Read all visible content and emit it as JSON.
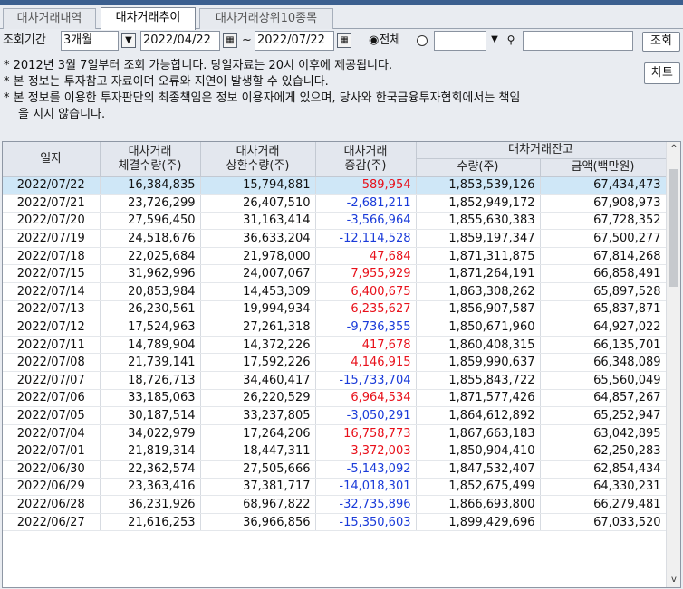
{
  "tabs": [
    {
      "label": "대차거래내역",
      "active": false
    },
    {
      "label": "대차거래추이",
      "active": true
    },
    {
      "label": "대차거래상위10종목",
      "active": false
    }
  ],
  "filter": {
    "period_label": "조회기간",
    "period_value": "3개월",
    "start_date": "2022/04/22",
    "end_date": "2022/07/22",
    "tilde": "~",
    "all_label": "◉전체",
    "stock_code": "",
    "stock_name": "",
    "search_button": "조회",
    "chart_button": "차트"
  },
  "notes": [
    "* 2012년 3월 7일부터 조회 가능합니다. 당일자료는 20시 이후에 제공됩니다.",
    "* 본 정보는 투자참고 자료이며 오류와 지연이 발생할 수 있습니다.",
    "* 본 정보를 이용한 투자판단의 최종책임은 정보 이용자에게 있으며, 당사와 한국금융투자협회에서는 책임",
    "을 지지 않습니다."
  ],
  "table": {
    "headers": {
      "date": "일자",
      "contract_l1": "대차거래",
      "contract_l2": "체결수량(주)",
      "repay_l1": "대차거래",
      "repay_l2": "상환수량(주)",
      "change_l1": "대차거래",
      "change_l2": "증감(주)",
      "balance": "대차거래잔고",
      "bal_qty": "수량(주)",
      "bal_amt": "금액(백만원)"
    },
    "rows": [
      {
        "date": "2022/07/22",
        "contract": "16,384,835",
        "repay": "15,794,881",
        "change": "589,954",
        "qty": "1,853,539,126",
        "amt": "67,434,473"
      },
      {
        "date": "2022/07/21",
        "contract": "23,726,299",
        "repay": "26,407,510",
        "change": "-2,681,211",
        "qty": "1,852,949,172",
        "amt": "67,908,973"
      },
      {
        "date": "2022/07/20",
        "contract": "27,596,450",
        "repay": "31,163,414",
        "change": "-3,566,964",
        "qty": "1,855,630,383",
        "amt": "67,728,352"
      },
      {
        "date": "2022/07/19",
        "contract": "24,518,676",
        "repay": "36,633,204",
        "change": "-12,114,528",
        "qty": "1,859,197,347",
        "amt": "67,500,277"
      },
      {
        "date": "2022/07/18",
        "contract": "22,025,684",
        "repay": "21,978,000",
        "change": "47,684",
        "qty": "1,871,311,875",
        "amt": "67,814,268"
      },
      {
        "date": "2022/07/15",
        "contract": "31,962,996",
        "repay": "24,007,067",
        "change": "7,955,929",
        "qty": "1,871,264,191",
        "amt": "66,858,491"
      },
      {
        "date": "2022/07/14",
        "contract": "20,853,984",
        "repay": "14,453,309",
        "change": "6,400,675",
        "qty": "1,863,308,262",
        "amt": "65,897,528"
      },
      {
        "date": "2022/07/13",
        "contract": "26,230,561",
        "repay": "19,994,934",
        "change": "6,235,627",
        "qty": "1,856,907,587",
        "amt": "65,837,871"
      },
      {
        "date": "2022/07/12",
        "contract": "17,524,963",
        "repay": "27,261,318",
        "change": "-9,736,355",
        "qty": "1,850,671,960",
        "amt": "64,927,022"
      },
      {
        "date": "2022/07/11",
        "contract": "14,789,904",
        "repay": "14,372,226",
        "change": "417,678",
        "qty": "1,860,408,315",
        "amt": "66,135,701"
      },
      {
        "date": "2022/07/08",
        "contract": "21,739,141",
        "repay": "17,592,226",
        "change": "4,146,915",
        "qty": "1,859,990,637",
        "amt": "66,348,089"
      },
      {
        "date": "2022/07/07",
        "contract": "18,726,713",
        "repay": "34,460,417",
        "change": "-15,733,704",
        "qty": "1,855,843,722",
        "amt": "65,560,049"
      },
      {
        "date": "2022/07/06",
        "contract": "33,185,063",
        "repay": "26,220,529",
        "change": "6,964,534",
        "qty": "1,871,577,426",
        "amt": "64,857,267"
      },
      {
        "date": "2022/07/05",
        "contract": "30,187,514",
        "repay": "33,237,805",
        "change": "-3,050,291",
        "qty": "1,864,612,892",
        "amt": "65,252,947"
      },
      {
        "date": "2022/07/04",
        "contract": "34,022,979",
        "repay": "17,264,206",
        "change": "16,758,773",
        "qty": "1,867,663,183",
        "amt": "63,042,895"
      },
      {
        "date": "2022/07/01",
        "contract": "21,819,314",
        "repay": "18,447,311",
        "change": "3,372,003",
        "qty": "1,850,904,410",
        "amt": "62,250,283"
      },
      {
        "date": "2022/06/30",
        "contract": "22,362,574",
        "repay": "27,505,666",
        "change": "-5,143,092",
        "qty": "1,847,532,407",
        "amt": "62,854,434"
      },
      {
        "date": "2022/06/29",
        "contract": "23,363,416",
        "repay": "37,381,717",
        "change": "-14,018,301",
        "qty": "1,852,675,499",
        "amt": "64,330,231"
      },
      {
        "date": "2022/06/28",
        "contract": "36,231,926",
        "repay": "68,967,822",
        "change": "-32,735,896",
        "qty": "1,866,693,800",
        "amt": "66,279,481"
      },
      {
        "date": "2022/06/27",
        "contract": "21,616,253",
        "repay": "36,966,856",
        "change": "-15,350,603",
        "qty": "1,899,429,696",
        "amt": "67,033,520"
      }
    ]
  },
  "colors": {
    "positive": "#e8101a",
    "negative": "#1a3bd9",
    "selected_row": "#cfe7f7",
    "header_bar": "#3b5f8f"
  }
}
